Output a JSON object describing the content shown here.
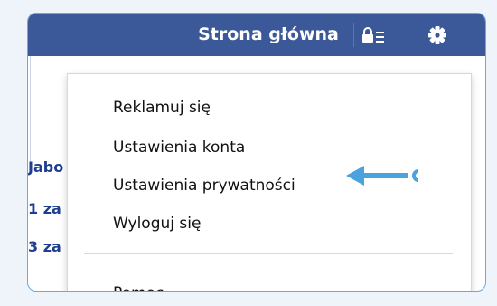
{
  "topbar": {
    "home_label": "Strona główna",
    "privacy_icon": "lock-list-icon",
    "settings_icon": "gear-icon",
    "bar_color": "#3b5998"
  },
  "background_text": {
    "line1": "Jabo",
    "line2": "1 za",
    "line3": "3 za"
  },
  "menu": {
    "items": [
      {
        "label": "Reklamuj się"
      },
      {
        "label": "Ustawienia konta"
      },
      {
        "label": "Ustawienia prywatności"
      },
      {
        "label": "Wyloguj się"
      },
      {
        "label": "Pomoc"
      }
    ]
  },
  "annotation": {
    "arrow_color": "#4aa3df",
    "icon": "left-arrow-icon"
  }
}
